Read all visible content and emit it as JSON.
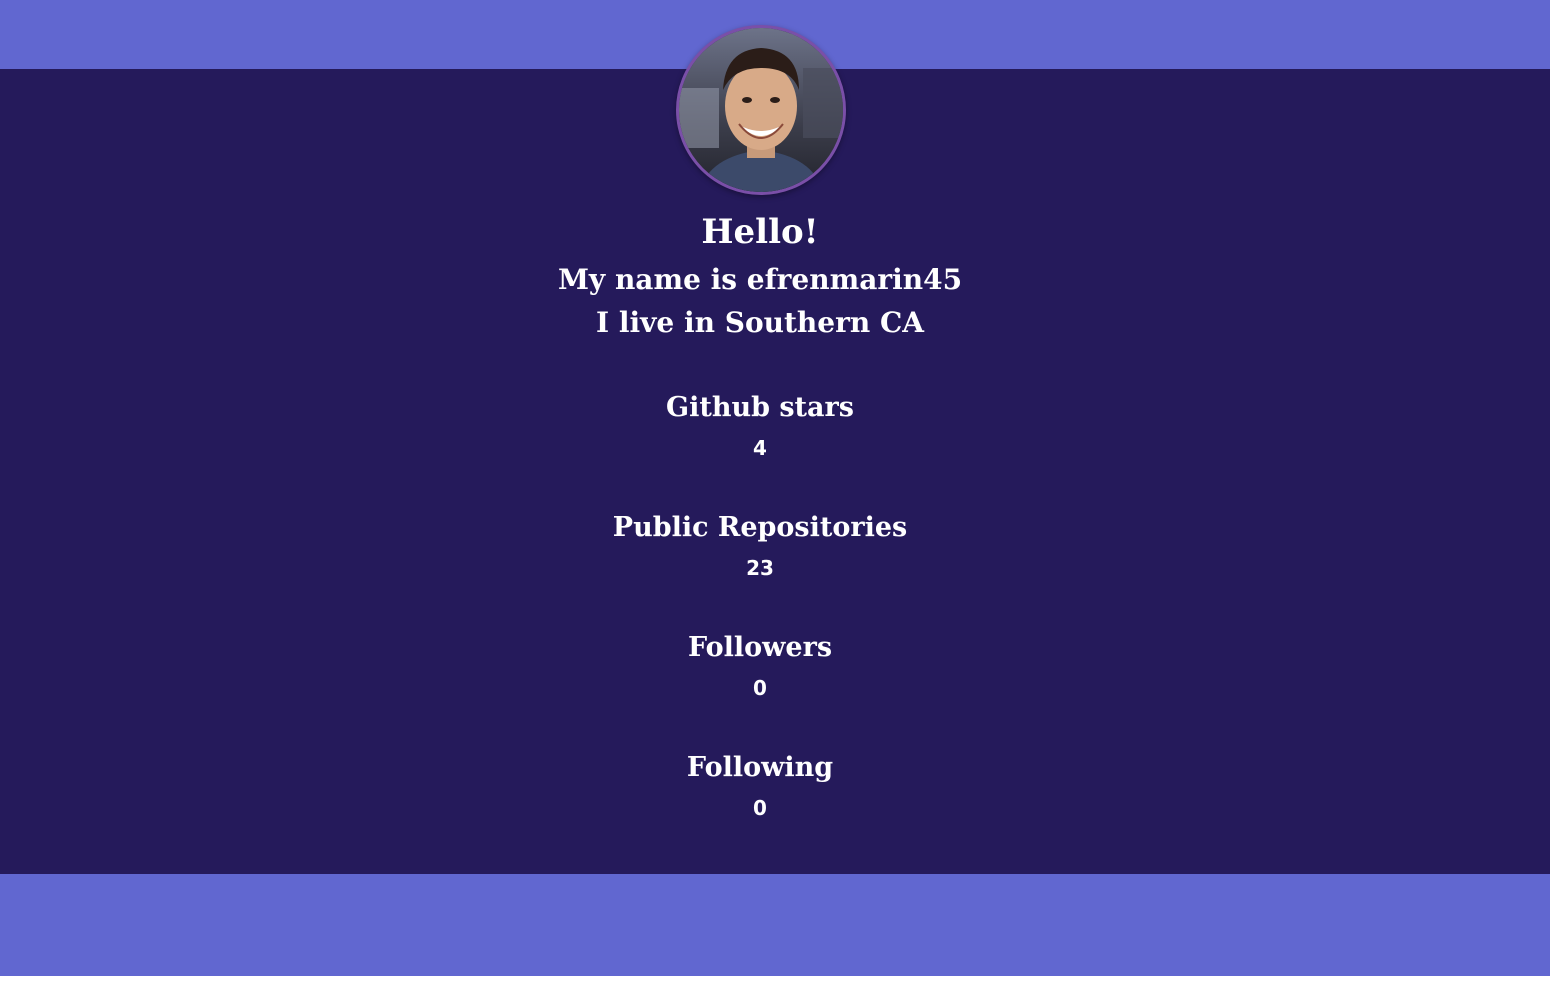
{
  "profile": {
    "greeting": "Hello!",
    "name_line": "My name is efrenmarin45",
    "location_line": "I live in Southern CA",
    "avatar_icon": "user-photo"
  },
  "stats": [
    {
      "label": "Github stars",
      "value": "4"
    },
    {
      "label": "Public Repositories",
      "value": "23"
    },
    {
      "label": "Followers",
      "value": "0"
    },
    {
      "label": "Following",
      "value": "0"
    }
  ],
  "colors": {
    "band": "#6167d0",
    "panel": "#251a5b",
    "text": "#ffffff",
    "avatar_border": "#7a4fa8"
  }
}
